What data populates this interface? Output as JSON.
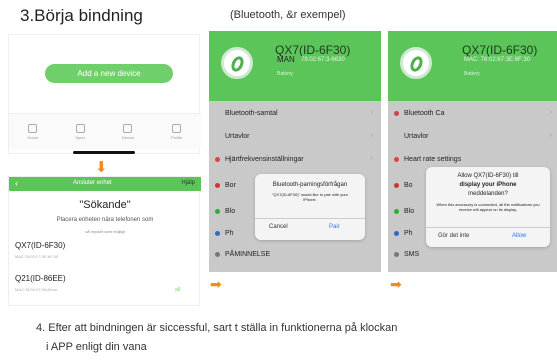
{
  "title": "3.Börja bindning",
  "subtitle": "(Bluetooth, &r exempel)",
  "panel1": {
    "add_button": "Add a new device",
    "tabs": [
      "Home",
      "Sport",
      "Device",
      "Profile"
    ]
  },
  "panel2": {
    "header_title": "Ansluter enhet",
    "header_help": "Hjälp",
    "searching": "\"Sökande\"",
    "place_near": "Placera enheten nära telefonen som",
    "place_near2": "så mycket som möjligt",
    "devices": [
      {
        "name": "QX7(ID-6F30)",
        "mac": "MAC:78:02:F7:3E:6F:30"
      },
      {
        "name": "Q21(ID-86EE)",
        "mac": "MAC:78:02:07:35:86:ee"
      }
    ],
    "signal": "all"
  },
  "panel3": {
    "device_name": "QX7(ID-6F30)",
    "man": "MAN",
    "mac": "78:02:67:3-6630",
    "battery": "Battery",
    "items": [
      "Bluetooth-samtal",
      "Urtavlor",
      "Hjärtfrekvensinställningar",
      "Bor",
      "Blo",
      "Ph",
      "PÅMINNELSE"
    ],
    "dialog_title": "Bluetooth-parningsförfrågan",
    "dialog_text": "\"QX7(ID-6F30)\" would like to pair with your iPhone.",
    "cancel": "Cancel",
    "pair": "Pair"
  },
  "panel4": {
    "device_name": "QX7(ID-6F30)",
    "mac": "MAC: 78:02:67:3E:6F:30",
    "battery": "Battery",
    "items": [
      "Bluetooth Ca",
      "Urtavlor",
      "Heart rate settings",
      "Bo",
      "Blo",
      "Ph",
      "SMS"
    ],
    "dialog_l1": "Allow QX7(ID-6F30) till",
    "dialog_l2": "display your iPhone",
    "dialog_l3": "meddelanden?",
    "dialog_text": "When this accessory is connected, all the notifications you receive will appear on its display.",
    "dont": "Gör det inte",
    "allow": "Allow"
  },
  "footer_line1": "4. Efter att bindningen är siccessful, sart t ställa in funktionerna på klockan",
  "footer_line2": "i APP enligt din vana",
  "colors": {
    "green": "#5cc55a",
    "orange": "#f08a24"
  }
}
